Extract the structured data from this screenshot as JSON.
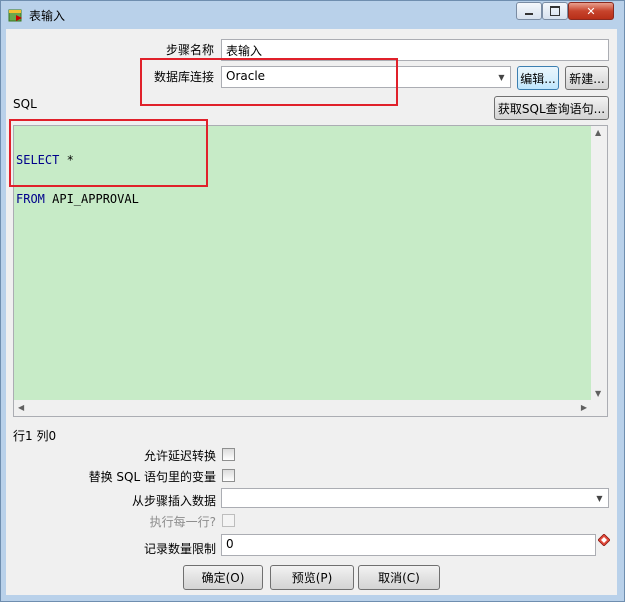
{
  "window": {
    "title": "表输入"
  },
  "form": {
    "step_name_label": "步骤名称",
    "step_name_value": "表输入",
    "db_conn_label": "数据库连接",
    "db_conn_value": "Oracle",
    "edit_button": "编辑...",
    "new_button": "新建...",
    "sql_label": "SQL",
    "get_sql_button": "获取SQL查询语句...",
    "sql_lines": [
      {
        "keyword": "SELECT",
        "rest": " *"
      },
      {
        "keyword": "FROM",
        "rest": " API_APPROVAL"
      }
    ],
    "cursor_status": "行1 列0",
    "allow_lazy_label": "允许延迟转换",
    "replace_vars_label": "替换 SQL 语句里的变量",
    "insert_from_step_label": "从步骤插入数据",
    "insert_from_step_value": "",
    "execute_each_row_label": "执行每一行?",
    "limit_label": "记录数量限制",
    "limit_value": "0"
  },
  "buttons": {
    "ok": "确定(O)",
    "preview": "预览(P)",
    "cancel": "取消(C)"
  },
  "annotation_color": "#e0202a",
  "editor_bg": "#c7ebc7"
}
